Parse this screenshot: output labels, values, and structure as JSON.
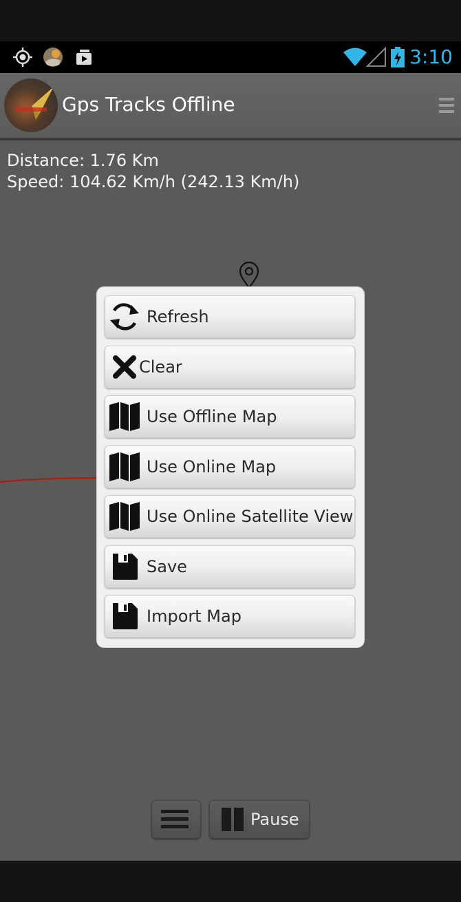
{
  "status_bar": {
    "time": "3:10",
    "accent_color": "#33b5e5",
    "icons": [
      "gps-icon",
      "photo-notification-icon",
      "media-notification-icon",
      "wifi-icon",
      "signal-icon",
      "battery-charging-icon"
    ]
  },
  "action_bar": {
    "title": "Gps Tracks Offline",
    "logo_icon": "app-logo",
    "overflow_icon": "overflow-menu-icon"
  },
  "stats": {
    "distance": "Distance: 1.76 Km",
    "speed": "Speed: 104.62 Km/h (242.13 Km/h)"
  },
  "menu": {
    "items": [
      {
        "label": "Refresh",
        "icon": "refresh-icon"
      },
      {
        "label": "Clear",
        "icon": "close-icon"
      },
      {
        "label": "Use Offline Map",
        "icon": "map-icon"
      },
      {
        "label": "Use Online Map",
        "icon": "map-icon"
      },
      {
        "label": "Use Online Satellite View",
        "icon": "map-icon"
      },
      {
        "label": "Save",
        "icon": "save-icon"
      },
      {
        "label": "Import Map",
        "icon": "save-icon"
      }
    ]
  },
  "controls": {
    "menu_icon": "hamburger-icon",
    "pause_label": "Pause",
    "pause_icon": "pause-icon"
  },
  "colors": {
    "map_background": "#5a5a58",
    "track_line": "#b01818",
    "dialog_background": "#f0f0f0"
  }
}
